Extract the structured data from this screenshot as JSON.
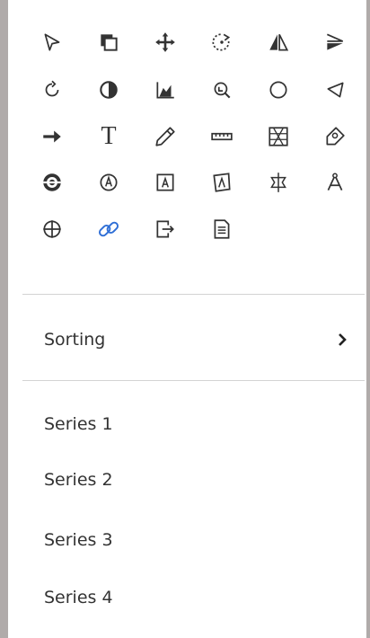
{
  "toolbar": {
    "tools": [
      {
        "icon": "pointer-arrow-icon"
      },
      {
        "icon": "duplicate-icon"
      },
      {
        "icon": "move-icon"
      },
      {
        "icon": "rotate-dotted-icon"
      },
      {
        "icon": "mirror-icon"
      },
      {
        "icon": "flag-icon"
      },
      {
        "icon": "rotate-circle-icon"
      },
      {
        "icon": "contrast-icon"
      },
      {
        "icon": "chart-icon"
      },
      {
        "icon": "zoom-out-icon"
      },
      {
        "icon": "circle-icon"
      },
      {
        "icon": "shape-icon"
      },
      {
        "icon": "right-arrow-icon"
      },
      {
        "icon": "text-icon",
        "glyph": "T"
      },
      {
        "icon": "pencil-icon"
      },
      {
        "icon": "ruler-icon"
      },
      {
        "icon": "pattern-icon"
      },
      {
        "icon": "tag-icon"
      },
      {
        "icon": "eye-icon"
      },
      {
        "icon": "at-sign-icon"
      },
      {
        "icon": "framed-symbol-icon"
      },
      {
        "icon": "tilted-frame-icon"
      },
      {
        "icon": "perspective-icon"
      },
      {
        "icon": "compass-icon"
      },
      {
        "icon": "crosshair-icon"
      },
      {
        "icon": "link-icon"
      },
      {
        "icon": "export-icon"
      },
      {
        "icon": "document-icon"
      }
    ],
    "accent_color": "#2f6fd6"
  },
  "menu": {
    "sorting_label": "Sorting",
    "series": [
      "Series 1",
      "Series 2",
      "Series 3",
      "Series 4"
    ]
  }
}
